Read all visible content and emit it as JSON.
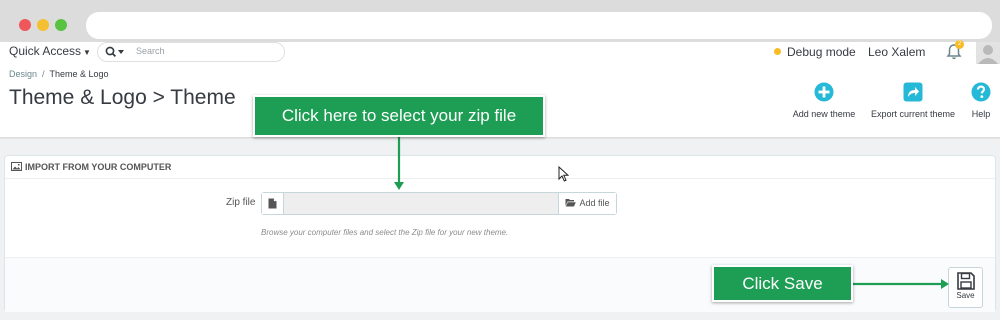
{
  "header": {
    "quick_access": "Quick Access",
    "search_placeholder": "Search",
    "debug_mode": "Debug mode",
    "user_name": "Leo Xalem",
    "notification_count": "2"
  },
  "breadcrumb": {
    "parent": "Design",
    "separator": "/",
    "current": "Theme & Logo"
  },
  "page": {
    "title": "Theme & Logo > Theme"
  },
  "toolbar": {
    "add_new_theme": "Add new theme",
    "export_current_theme": "Export current theme",
    "help": "Help"
  },
  "panel": {
    "heading": "IMPORT FROM YOUR COMPUTER",
    "zip_label": "Zip file",
    "add_file_label": "Add file",
    "help_text": "Browse your computer files and select the Zip file for your new theme.",
    "save_label": "Save"
  },
  "callouts": {
    "zip": "Click here to select your zip file",
    "save": "Click Save"
  },
  "colors": {
    "accent": "#25b9d7",
    "callout_green": "#1e9e54",
    "debug_dot": "#fbbb22"
  }
}
